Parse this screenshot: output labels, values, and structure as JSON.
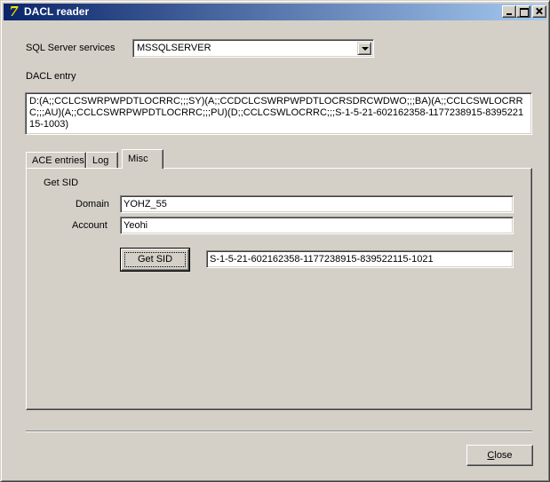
{
  "window": {
    "title": "DACL reader",
    "icon": "delphi-app-icon"
  },
  "sql_services": {
    "label": "SQL Server services",
    "selected": "MSSQLSERVER"
  },
  "dacl": {
    "label": "DACL entry",
    "value": "D:(A;;CCLCSWRPWPDTLOCRRC;;;SY)(A;;CCDCLCSWRPWPDTLOCRSDRCWDWO;;;BA)(A;;CCLCSWLOCRRC;;;AU)(A;;CCLCSWRPWPDTLOCRRC;;;PU)(D;;CCLCSWLOCRRC;;;S-1-5-21-602162358-1177238915-839522115-1003)"
  },
  "tabs": [
    {
      "label": "ACE entries",
      "active": false
    },
    {
      "label": "Log",
      "active": false
    },
    {
      "label": "Misc",
      "active": true
    }
  ],
  "misc": {
    "group_label": "Get SID",
    "domain_label": "Domain",
    "domain_value": "YOHZ_55",
    "account_label": "Account",
    "account_value": "Yeohi",
    "get_sid_label": "Get SID",
    "sid_result": "S-1-5-21-602162358-1177238915-839522115-1021"
  },
  "footer": {
    "close_label": "Close"
  }
}
